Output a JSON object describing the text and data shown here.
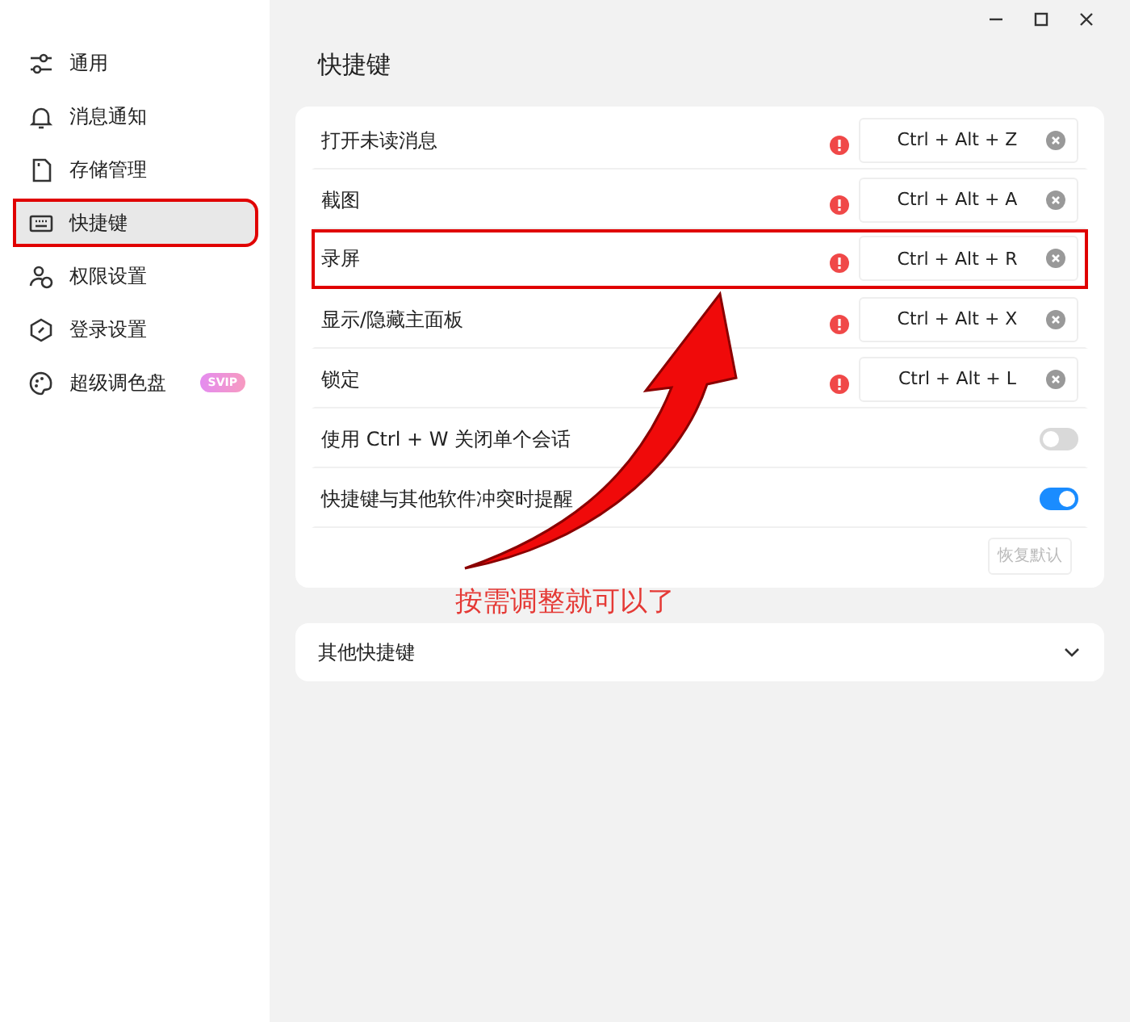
{
  "sidebar": {
    "items": [
      {
        "kind": "sliders",
        "label": "通用",
        "selected": false,
        "highlighted": false
      },
      {
        "kind": "bell",
        "label": "消息通知",
        "selected": false,
        "highlighted": false
      },
      {
        "kind": "card",
        "label": "存储管理",
        "selected": false,
        "highlighted": false
      },
      {
        "kind": "keyboard",
        "label": "快捷键",
        "selected": true,
        "highlighted": true
      },
      {
        "kind": "people",
        "label": "权限设置",
        "selected": false,
        "highlighted": false
      },
      {
        "kind": "hexagon",
        "label": "登录设置",
        "selected": false,
        "highlighted": false
      },
      {
        "kind": "palette",
        "label": "超级调色盘",
        "selected": false,
        "highlighted": false,
        "badge": "SVIP"
      }
    ]
  },
  "page_title": "快捷键",
  "shortcuts": [
    {
      "label": "打开未读消息",
      "warning": true,
      "keys": "Ctrl + Alt + Z",
      "highlighted": false
    },
    {
      "label": "截图",
      "warning": true,
      "keys": "Ctrl + Alt + A",
      "highlighted": false
    },
    {
      "label": "录屏",
      "warning": true,
      "keys": "Ctrl + Alt + R",
      "highlighted": true
    },
    {
      "label": "显示/隐藏主面板",
      "warning": true,
      "keys": "Ctrl + Alt + X",
      "highlighted": false
    },
    {
      "label": "锁定",
      "warning": true,
      "keys": "Ctrl + Alt + L",
      "highlighted": false
    }
  ],
  "toggles": [
    {
      "label": "使用 Ctrl + W 关闭单个会话",
      "on": false
    },
    {
      "label": "快捷键与其他软件冲突时提醒",
      "on": true
    }
  ],
  "restore_button": {
    "label": "恢复默认",
    "disabled": true
  },
  "other_section": {
    "label": "其他快捷键",
    "expanded": false
  },
  "annotation": {
    "text": "按需调整就可以了"
  }
}
